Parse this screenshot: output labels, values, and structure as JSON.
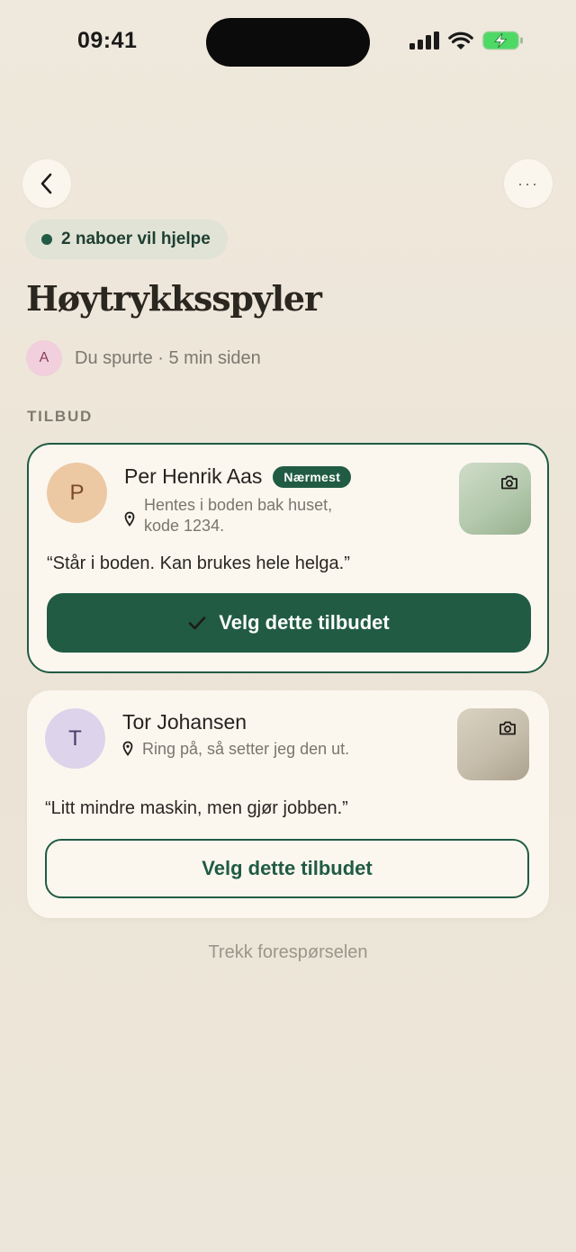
{
  "status_bar": {
    "time": "09:41"
  },
  "chip": {
    "label": "2 naboer vil hjelpe"
  },
  "request": {
    "title": "Høytrykksspyler",
    "asker_initial": "A",
    "meta": "Du spurte · 5 min siden"
  },
  "offers_section_label": "TILBUD",
  "offers": [
    {
      "initial": "P",
      "name": "Per Henrik Aas",
      "badge": "Nærmest",
      "location_line1": "Hentes i boden bak huset,",
      "location_line2": "kode 1234.",
      "quote": "“Står i boden. Kan brukes hele helga.”",
      "button_label": "Velg dette tilbudet"
    },
    {
      "initial": "T",
      "name": "Tor Johansen",
      "location_line1": "Ring på, så setter jeg den ut.",
      "quote": "“Litt mindre maskin, men gjør jobben.”",
      "button_label": "Velg dette tilbudet"
    }
  ],
  "withdraw_label": "Trekk forespørselen",
  "more_label": "···",
  "icons": {
    "back": "chevron-left-icon",
    "more": "more-icon",
    "pin": "location-pin-icon",
    "camera": "camera-icon",
    "check": "checkmark-icon"
  },
  "colors": {
    "accent": "#215b44",
    "background": "#eee7da",
    "card": "#fbf7ef"
  }
}
